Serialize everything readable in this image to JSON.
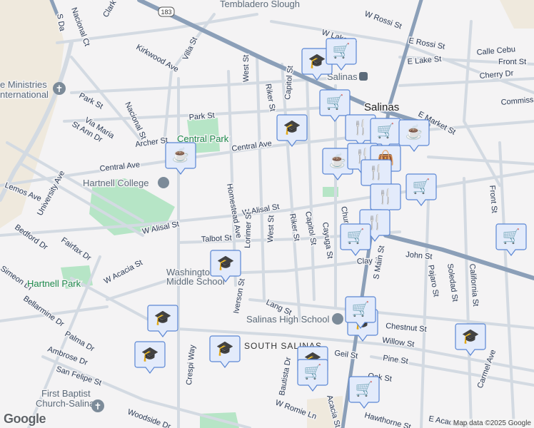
{
  "colors": {
    "background": "#f4f3f4",
    "road": "#d3dae2",
    "highway": "#8b9fb8",
    "park": "#b6e5c6",
    "sand": "#efe9dd",
    "marker_fill": "#e3ebfb",
    "marker_border": "#5a86d4",
    "marker_icon": "#0b3e66"
  },
  "places": {
    "city": "Salinas",
    "station": "Salinas",
    "neighborhood": "SOUTH SALINAS",
    "central_park": "Central Park",
    "hartnell_park": "Hartnell Park",
    "tembladero": "Tembladero Slough",
    "hartnell_college": "Hartnell College",
    "washington_1": "Washington",
    "washington_2": "Middle School",
    "salinas_high": "Salinas High School",
    "ministries_1": "e Ministries",
    "ministries_2": "nternational",
    "baptist_1": "First Baptist",
    "baptist_2": "Church-Salinas",
    "highway_shield": "183"
  },
  "streets": [
    "Nacional Ct",
    "Clark St",
    "Kirkwood Ave",
    "Villa St",
    "West St",
    "Riker St",
    "Capitol St",
    "Park St",
    "Via Maria",
    "St Ann Dr",
    "Nacional St",
    "Park St",
    "Archer St",
    "Central Ave",
    "Central Ave",
    "Lemos Ave",
    "University Ave",
    "W Alisal St",
    "W Alisal St",
    "Talbot St",
    "Lorimer St",
    "West St",
    "Riker St",
    "Capitol St",
    "Cayuga St",
    "Church St",
    "Homestead Ave",
    "Bedford Dr",
    "Fairfax Dr",
    "W Acacia St",
    "Simeon Dr",
    "Bellarmine Dr",
    "Iverson St",
    "Lang St",
    "Clay St",
    "John St",
    "Chestnut St",
    "Willow St",
    "Pine St",
    "Geil St",
    "Oak St",
    "Palma Dr",
    "Ambrose Dr",
    "San Felipe St",
    "Crespi Way",
    "Bautista Dr",
    "W Romie Ln",
    "Woodside Dr",
    "Acacia St",
    "Hawthorne St",
    "E Acacia St",
    "Pajaro St",
    "Soledad St",
    "California St",
    "Front St",
    "Carmel Ave",
    "W Rossi St",
    "E Rossi St",
    "W Lake St",
    "E Lake St",
    "Calle Cebu",
    "Cherry Dr",
    "E Market St",
    "Commiss",
    "S Main St",
    "S Da",
    "Front St"
  ],
  "markers": [
    {
      "type": "cafe"
    },
    {
      "type": "school"
    },
    {
      "type": "shopping"
    },
    {
      "type": "shopping"
    },
    {
      "type": "school"
    },
    {
      "type": "restaurant"
    },
    {
      "type": "shopping"
    },
    {
      "type": "cafe"
    },
    {
      "type": "cafe"
    },
    {
      "type": "restaurant"
    },
    {
      "type": "bag"
    },
    {
      "type": "restaurant"
    },
    {
      "type": "shopping"
    },
    {
      "type": "restaurant"
    },
    {
      "type": "restaurant"
    },
    {
      "type": "shopping"
    },
    {
      "type": "shopping"
    },
    {
      "type": "school"
    },
    {
      "type": "school"
    },
    {
      "type": "school"
    },
    {
      "type": "shopping"
    },
    {
      "type": "school"
    },
    {
      "type": "school"
    },
    {
      "type": "school"
    },
    {
      "type": "school"
    },
    {
      "type": "shopping"
    },
    {
      "type": "shopping"
    }
  ],
  "footer": {
    "google": "Google",
    "attribution": "Map data ©2025 Google"
  }
}
